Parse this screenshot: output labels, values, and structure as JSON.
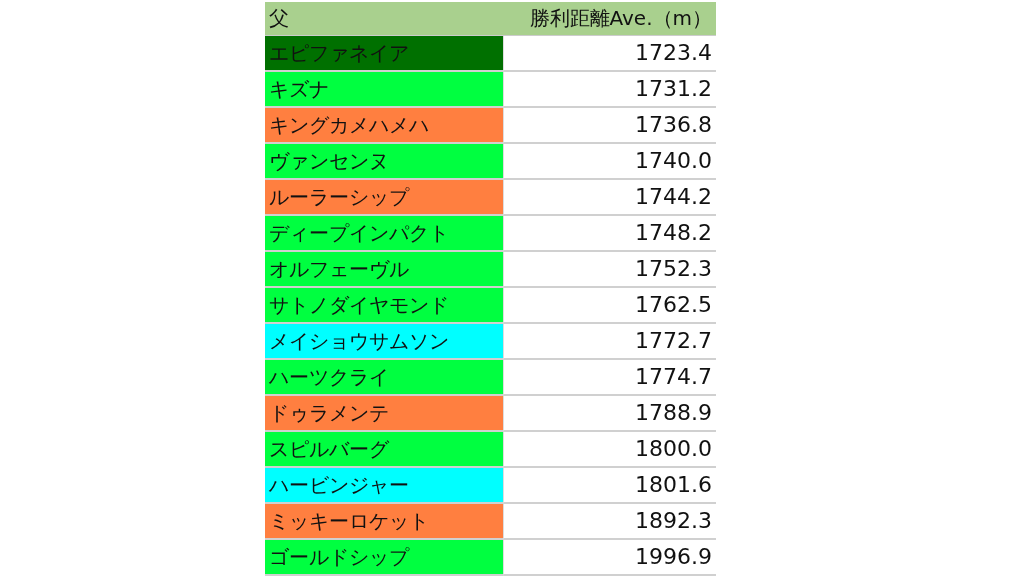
{
  "table": {
    "columns": [
      "父",
      "勝利距離Ave.（m）"
    ],
    "rows": [
      {
        "sire": "エピファネイア",
        "distance": "1723.4",
        "color": "#007000"
      },
      {
        "sire": "キズナ",
        "distance": "1731.2",
        "color": "#00ff40"
      },
      {
        "sire": "キングカメハメハ",
        "distance": "1736.8",
        "color": "#ff7f40"
      },
      {
        "sire": "ヴァンセンヌ",
        "distance": "1740.0",
        "color": "#00ff40"
      },
      {
        "sire": "ルーラーシップ",
        "distance": "1744.2",
        "color": "#ff7f40"
      },
      {
        "sire": "ディープインパクト",
        "distance": "1748.2",
        "color": "#00ff40"
      },
      {
        "sire": "オルフェーヴル",
        "distance": "1752.3",
        "color": "#00ff40"
      },
      {
        "sire": "サトノダイヤモンド",
        "distance": "1762.5",
        "color": "#00ff40"
      },
      {
        "sire": "メイショウサムソン",
        "distance": "1772.7",
        "color": "#00ffff"
      },
      {
        "sire": "ハーツクライ",
        "distance": "1774.7",
        "color": "#00ff40"
      },
      {
        "sire": "ドゥラメンテ",
        "distance": "1788.9",
        "color": "#ff7f40"
      },
      {
        "sire": "スピルバーグ",
        "distance": "1800.0",
        "color": "#00ff40"
      },
      {
        "sire": "ハービンジャー",
        "distance": "1801.6",
        "color": "#00ffff"
      },
      {
        "sire": "ミッキーロケット",
        "distance": "1892.3",
        "color": "#ff7f40"
      },
      {
        "sire": "ゴールドシップ",
        "distance": "1996.9",
        "color": "#00ff40"
      }
    ]
  }
}
